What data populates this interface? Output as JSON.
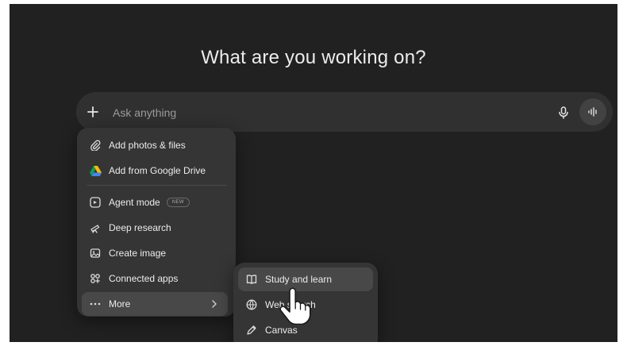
{
  "heading": "What are you working on?",
  "composer": {
    "placeholder": "Ask anything",
    "plus_icon": "plus-icon",
    "mic_icon": "microphone-icon",
    "voice_icon": "voice-mode-icon"
  },
  "menu": {
    "items": [
      {
        "label": "Add photos & files",
        "icon": "paperclip-icon"
      },
      {
        "label": "Add from Google Drive",
        "icon": "google-drive-icon"
      },
      {
        "label": "Agent mode",
        "icon": "agent-icon",
        "badge": "NEW"
      },
      {
        "label": "Deep research",
        "icon": "telescope-icon"
      },
      {
        "label": "Create image",
        "icon": "image-icon"
      },
      {
        "label": "Connected apps",
        "icon": "apps-icon"
      },
      {
        "label": "More",
        "icon": "ellipsis-icon"
      }
    ]
  },
  "submenu": {
    "items": [
      {
        "label": "Study and learn",
        "icon": "book-icon"
      },
      {
        "label": "Web search",
        "icon": "globe-icon"
      },
      {
        "label": "Canvas",
        "icon": "pen-icon"
      }
    ]
  },
  "colors": {
    "background": "#212121",
    "composer": "#303030",
    "menu": "#353535",
    "hover": "#484848",
    "text": "#ececec"
  }
}
